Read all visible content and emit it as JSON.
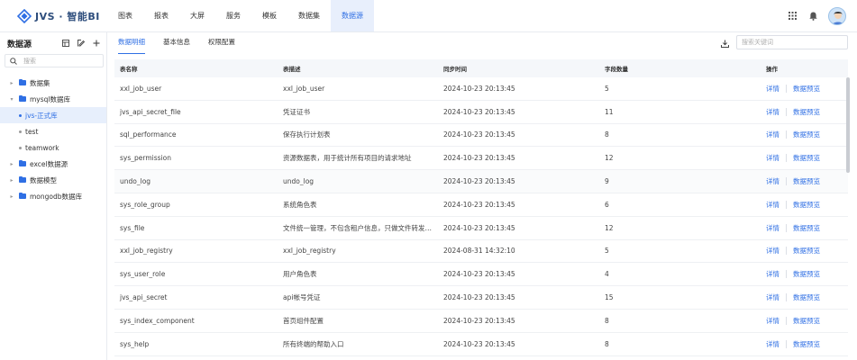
{
  "app": {
    "logo_text": "JVS · 智能BI",
    "accent": "#2f6fe4"
  },
  "nav": {
    "items": [
      {
        "label": "图表"
      },
      {
        "label": "报表"
      },
      {
        "label": "大屏"
      },
      {
        "label": "服务"
      },
      {
        "label": "模板"
      },
      {
        "label": "数据集"
      },
      {
        "label": "数据源",
        "active": true
      }
    ]
  },
  "header_icons": [
    "grid-apps-icon",
    "bell-icon",
    "user-avatar"
  ],
  "sidebar": {
    "title": "数据源",
    "action_icons": [
      "collapse-all-icon",
      "edit-icon",
      "add-icon"
    ],
    "search_placeholder": "搜索",
    "tree": [
      {
        "label": "数据集",
        "level": 0,
        "type": "folder",
        "expanded": false
      },
      {
        "label": "mysql数据库",
        "level": 0,
        "type": "folder",
        "expanded": true
      },
      {
        "label": "jvs-正式库",
        "level": 1,
        "type": "leaf",
        "selected": true
      },
      {
        "label": "test",
        "level": 1,
        "type": "leaf"
      },
      {
        "label": "teamwork",
        "level": 1,
        "type": "leaf"
      },
      {
        "label": "excel数据源",
        "level": 0,
        "type": "folder",
        "expanded": false
      },
      {
        "label": "数据模型",
        "level": 0,
        "type": "folder",
        "expanded": false
      },
      {
        "label": "mongodb数据库",
        "level": 0,
        "type": "folder",
        "expanded": false
      }
    ]
  },
  "main": {
    "tabs": [
      {
        "label": "数据明细",
        "active": true
      },
      {
        "label": "基本信息"
      },
      {
        "label": "权限配置"
      }
    ],
    "search_placeholder": "搜索关键词",
    "table": {
      "headers": [
        "表名称",
        "表描述",
        "同步时间",
        "字段数量",
        "操作"
      ],
      "actions": [
        "详情",
        "数据预览"
      ],
      "rows": [
        [
          "xxl_job_user",
          "xxl_job_user",
          "2024-10-23 20:13:45",
          "5"
        ],
        [
          "jvs_api_secret_file",
          "凭证证书",
          "2024-10-23 20:13:45",
          "11"
        ],
        [
          "sql_performance",
          "保存执行计划表",
          "2024-10-23 20:13:45",
          "8"
        ],
        [
          "sys_permission",
          "资源数据表，用于统计所有项目的请求地址",
          "2024-10-23 20:13:45",
          "12"
        ],
        [
          "undo_log",
          "undo_log",
          "2024-10-23 20:13:45",
          "9"
        ],
        [
          "sys_role_group",
          "系统角色表",
          "2024-10-23 20:13:45",
          "6"
        ],
        [
          "sys_file",
          "文件统一管理，不包含租户信息，只做文件转发和…",
          "2024-10-23 20:13:45",
          "12"
        ],
        [
          "xxl_job_registry",
          "xxl_job_registry",
          "2024-08-31 14:32:10",
          "5"
        ],
        [
          "sys_user_role",
          "用户角色表",
          "2024-10-23 20:13:45",
          "4"
        ],
        [
          "jvs_api_secret",
          "api帐号凭证",
          "2024-10-23 20:13:45",
          "15"
        ],
        [
          "sys_index_component",
          "首页组件配置",
          "2024-10-23 20:13:45",
          "8"
        ],
        [
          "sys_help",
          "所有终端的帮助入口",
          "2024-10-23 20:13:45",
          "8"
        ]
      ]
    }
  }
}
